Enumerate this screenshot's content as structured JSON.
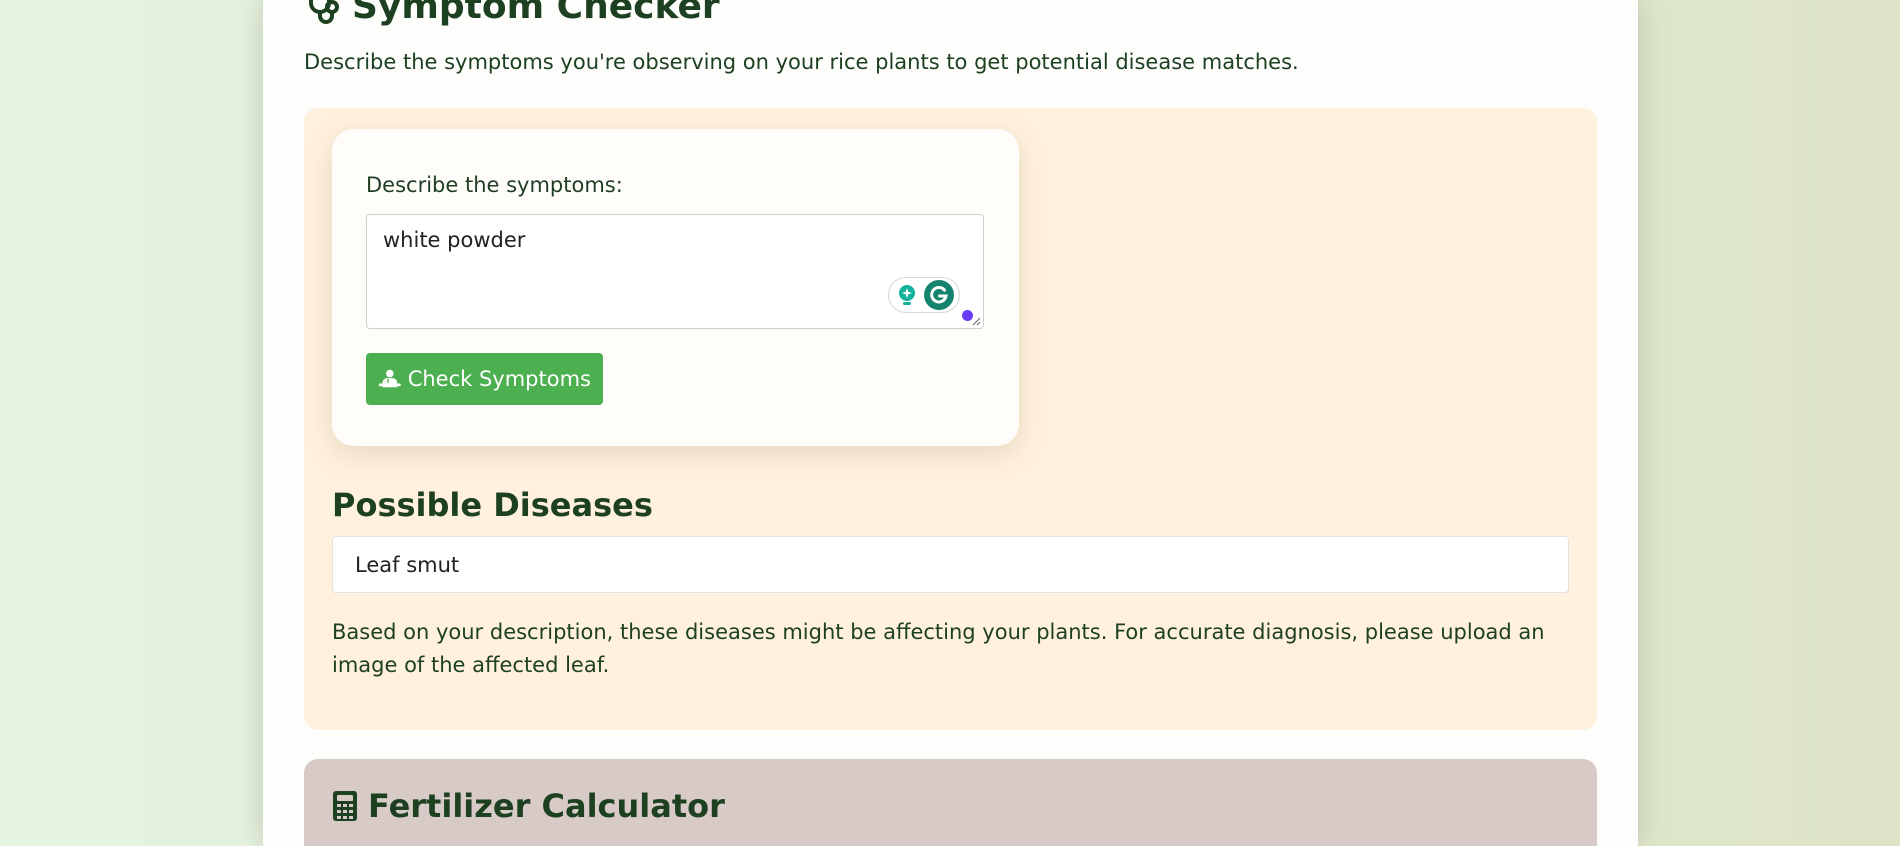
{
  "symptom_checker": {
    "title": "Symptom Checker",
    "title_icon": "stethoscope-icon",
    "description": "Describe the symptoms you're observing on your rice plants to get potential disease matches.",
    "form": {
      "label": "Describe the symptoms:",
      "value": "white powder",
      "button_label": "Check Symptoms",
      "button_icon": "doctor-icon"
    },
    "results": {
      "heading": "Possible Diseases",
      "items": [
        "Leaf smut"
      ],
      "note": "Based on your description, these diseases might be affecting your plants. For accurate diagnosis, please upload an image of the affected leaf."
    }
  },
  "fertilizer_calculator": {
    "title": "Fertilizer Calculator",
    "title_icon": "calculator-icon"
  },
  "colors": {
    "accent_green": "#4caf50",
    "heading_green": "#1d4020",
    "symptom_panel_bg": "#fff1de",
    "fertilizer_panel_bg": "#d8cac6",
    "assistant_dot": "#6b3af5"
  }
}
